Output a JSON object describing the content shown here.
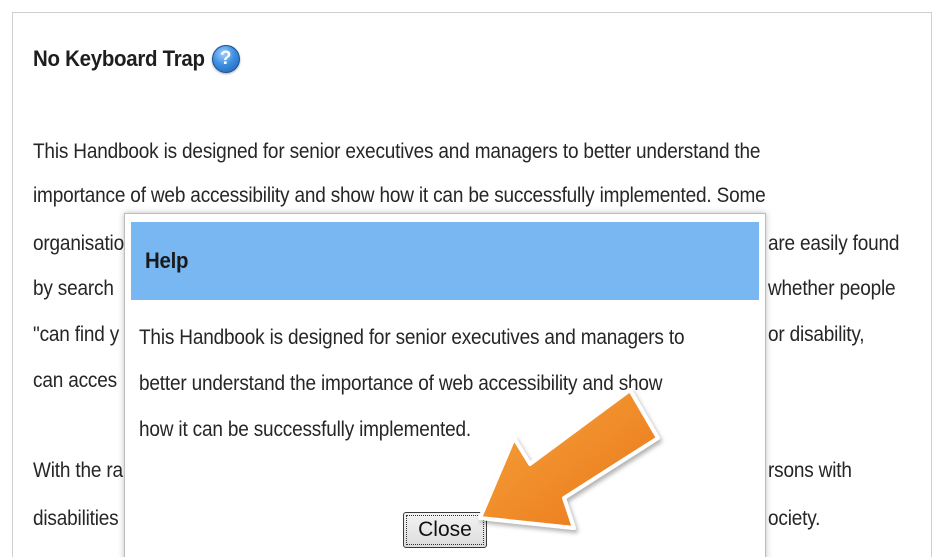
{
  "section": {
    "heading": "No Keyboard Trap",
    "help_icon_glyph": "?",
    "paragraph_lines": [
      "This Handbook is designed for senior executives and managers to better understand the",
      "importance of web accessibility and show how it can be successfully implemented. Some",
      "organisatio",
      "by search",
      "\"can find y",
      "can acces"
    ],
    "paragraph_line_tails": [
      "are easily found",
      "whether people",
      "or disability,"
    ],
    "second_paragraph_heads": [
      "With the ra",
      "disabilities"
    ],
    "second_paragraph_tails": [
      "rsons with",
      "ociety."
    ]
  },
  "dialog": {
    "title": "Help",
    "body_lines": [
      "This Handbook is designed for senior executives and managers to",
      "better understand the importance of web accessibility and show",
      "how it can be successfully implemented."
    ],
    "close_label": "Close"
  },
  "colors": {
    "dialog_header": "#79b7f2",
    "arrow": "#f28a1e",
    "help_icon": "#3f8fe0"
  }
}
